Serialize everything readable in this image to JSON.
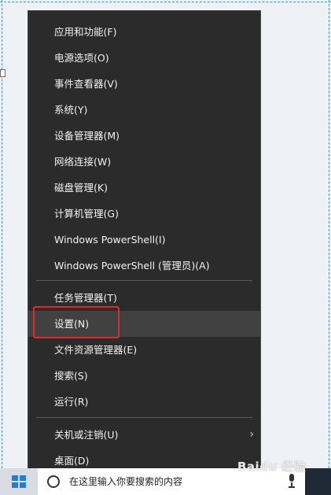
{
  "menu": {
    "items": [
      {
        "label": "应用和功能(F)"
      },
      {
        "label": "电源选项(O)"
      },
      {
        "label": "事件查看器(V)"
      },
      {
        "label": "系统(Y)"
      },
      {
        "label": "设备管理器(M)"
      },
      {
        "label": "网络连接(W)"
      },
      {
        "label": "磁盘管理(K)"
      },
      {
        "label": "计算机管理(G)"
      },
      {
        "label": "Windows PowerShell(I)"
      },
      {
        "label": "Windows PowerShell (管理员)(A)"
      },
      {
        "label": "任务管理器(T)"
      },
      {
        "label": "设置(N)",
        "highlighted": true
      },
      {
        "label": "文件资源管理器(E)"
      },
      {
        "label": "搜索(S)"
      },
      {
        "label": "运行(R)"
      },
      {
        "label": "关机或注销(U)",
        "submenu_arrow": "›"
      },
      {
        "label": "桌面(D)"
      }
    ],
    "highlight_color": "#e02b2b",
    "background_color": "#2b2b2b"
  },
  "taskbar": {
    "search_placeholder": "在这里输入你要搜索的内容",
    "start_icon": "windows-logo-icon",
    "mic_icon": "microphone-icon"
  },
  "watermark": {
    "text": "Baidu 经验"
  }
}
